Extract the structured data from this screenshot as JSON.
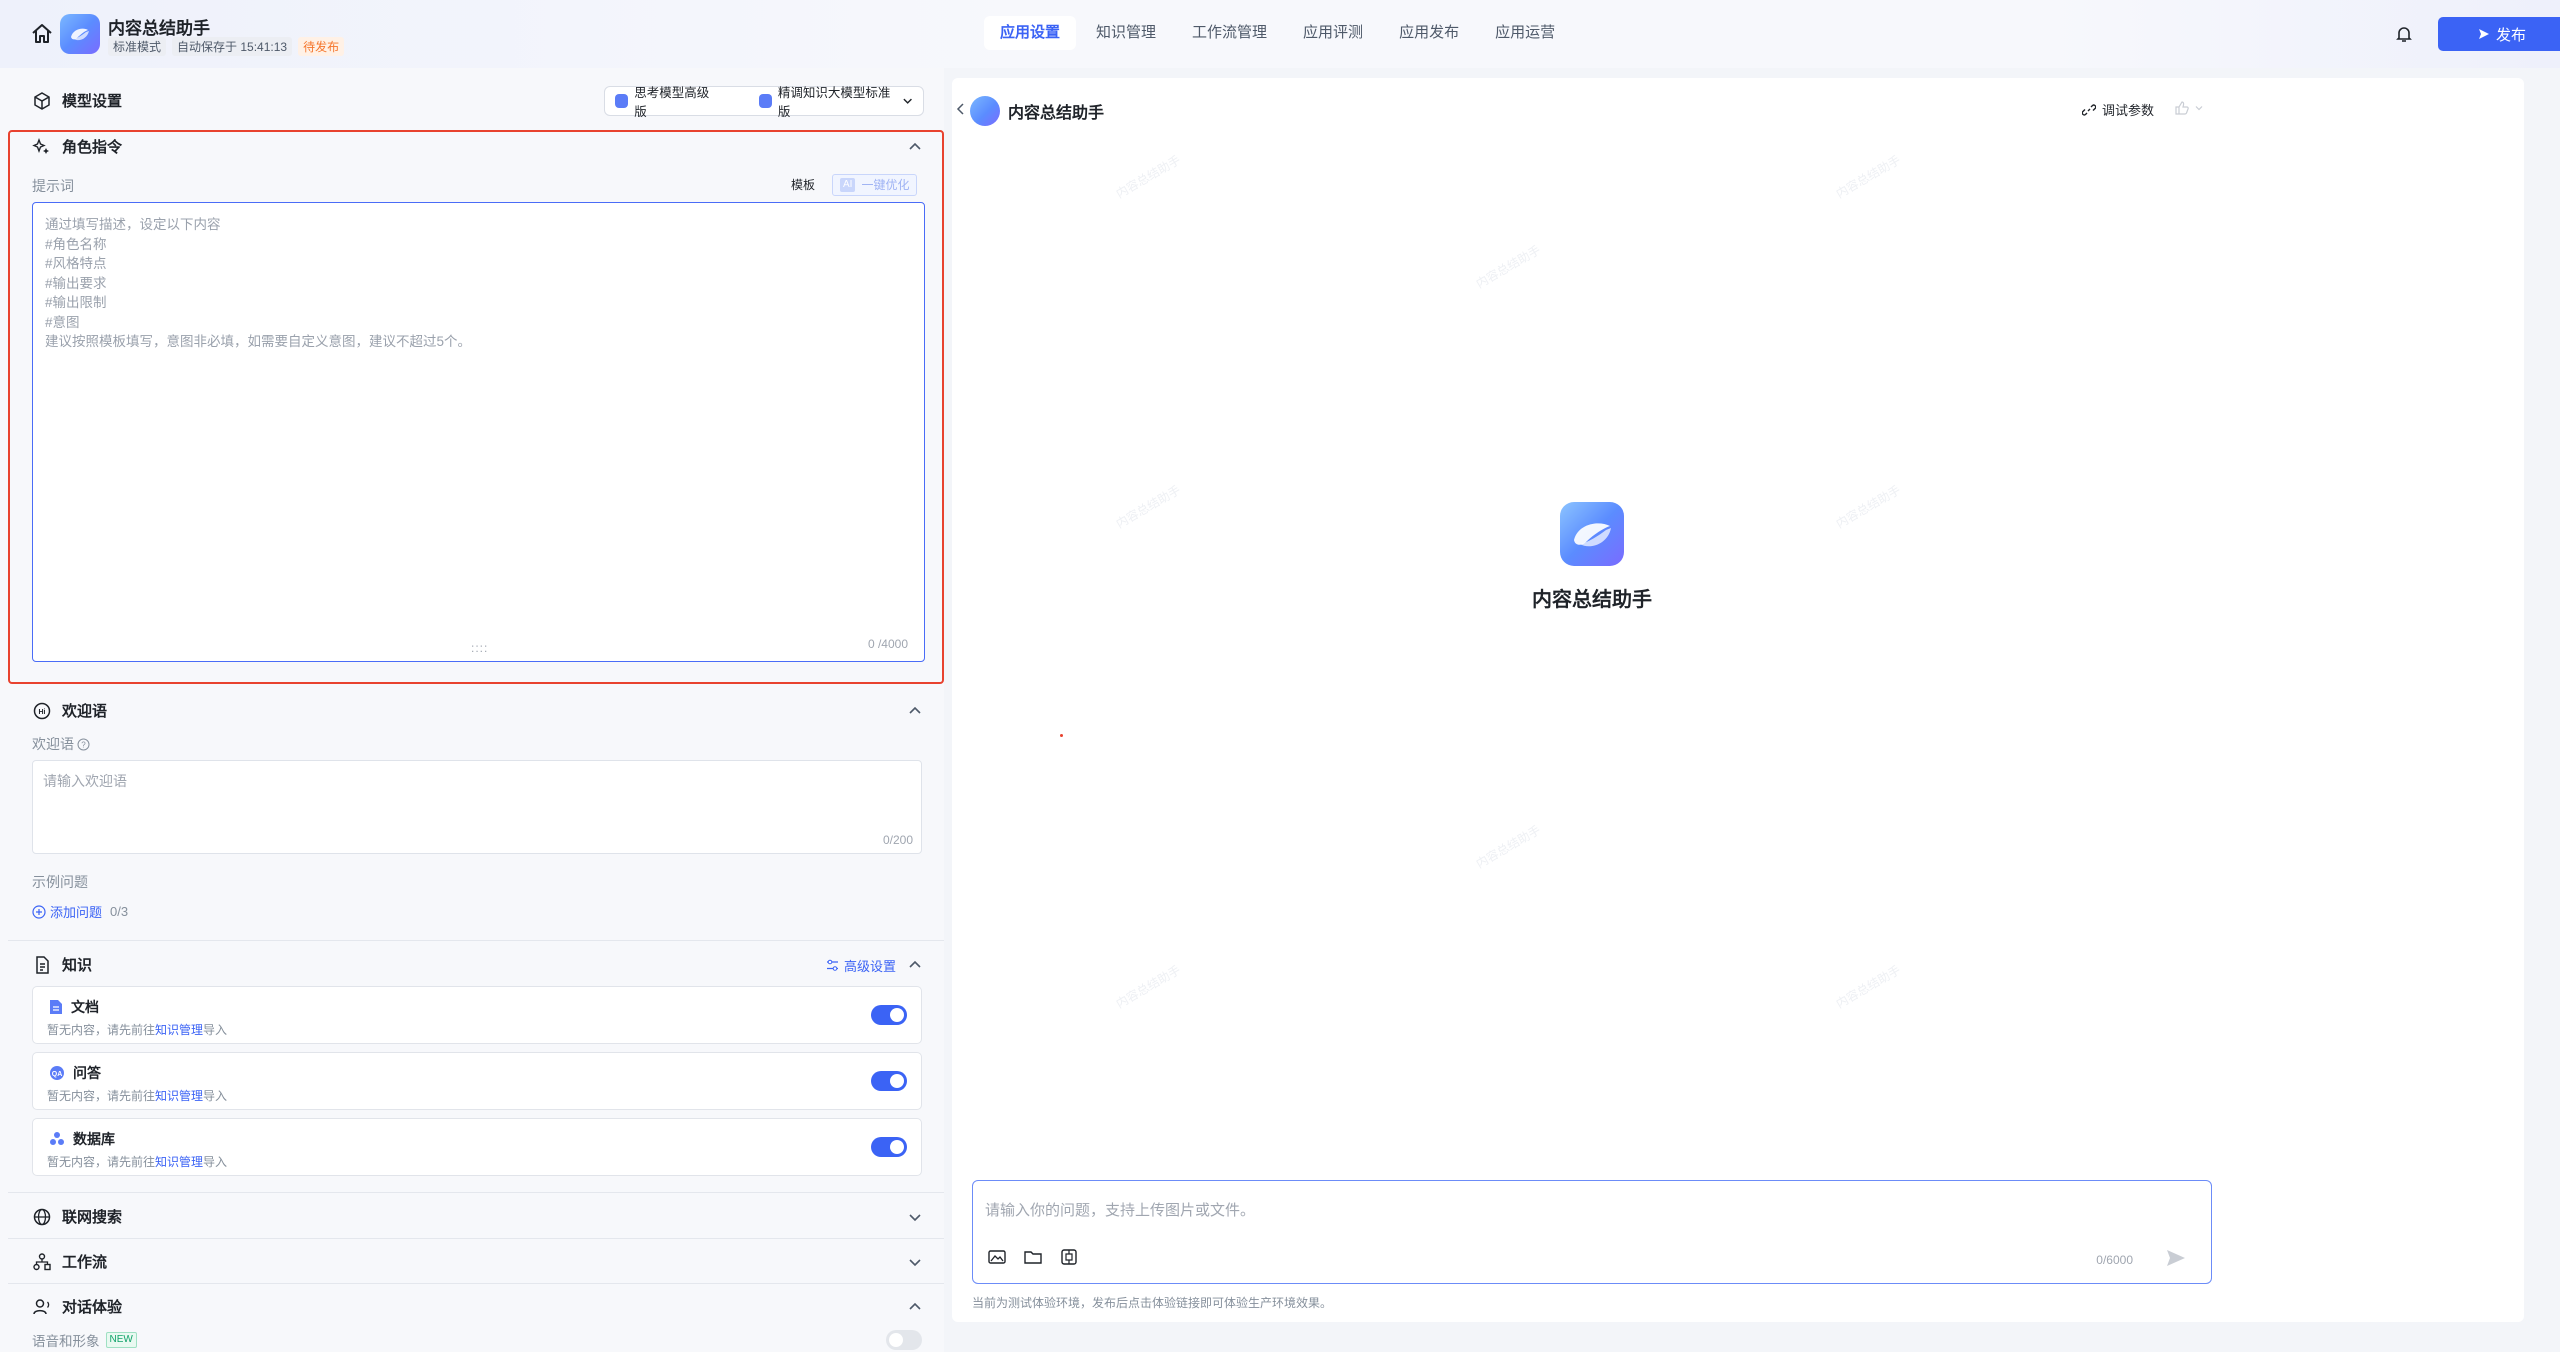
{
  "header": {
    "app_name": "内容总结助手",
    "mode": "标准模式",
    "autosave": "自动保存于 15:41:13",
    "status": "待发布",
    "tabs": [
      "应用设置",
      "知识管理",
      "工作流管理",
      "应用评测",
      "应用发布",
      "应用运营"
    ],
    "active_tab": "应用设置",
    "publish_label": "发布"
  },
  "model": {
    "title": "模型设置",
    "option_a": "思考模型高级版",
    "option_b": "精调知识大模型标准版"
  },
  "role": {
    "title": "角色指令",
    "prompt_label": "提示词",
    "template_btn": "模板",
    "optimize_badge": "AI",
    "optimize_btn": "一键优化",
    "placeholder": "通过填写描述，设定以下内容\n#角色名称\n#风格特点\n#输出要求\n#输出限制\n#意图\n建议按照模板填写，意图非必填，如需要自定义意图，建议不超过5个。",
    "counter": "0 /4000"
  },
  "welcome": {
    "title": "欢迎语",
    "label": "欢迎语",
    "placeholder": "请输入欢迎语",
    "counter": "0/200",
    "examples_label": "示例问题",
    "add_question": "添加问题",
    "add_count": "0/3"
  },
  "knowledge": {
    "title": "知识",
    "advanced": "高级设置",
    "items": [
      {
        "name": "文档",
        "desc": "暂无内容，请先前往",
        "link": "知识管理",
        "suffix": "导入",
        "enabled": true
      },
      {
        "name": "问答",
        "desc": "暂无内容，请先前往",
        "link": "知识管理",
        "suffix": "导入",
        "enabled": true
      },
      {
        "name": "数据库",
        "desc": "暂无内容，请先前往",
        "link": "知识管理",
        "suffix": "导入",
        "enabled": true
      }
    ]
  },
  "web_search": {
    "title": "联网搜索"
  },
  "workflow": {
    "title": "工作流"
  },
  "dialog": {
    "title": "对话体验",
    "voice_label": "语音和形象",
    "new_badge": "NEW",
    "voice_enabled": false
  },
  "chat": {
    "title": "内容总结助手",
    "debug_params": "调试参数",
    "center_name": "内容总结助手",
    "input_placeholder": "请输入你的问题，支持上传图片或文件。",
    "input_counter": "0/6000",
    "footnote": "当前为测试体验环境，发布后点击体验链接即可体验生产环境效果。"
  },
  "colors": {
    "accent": "#3b63f5",
    "highlight_border": "#e8422f",
    "pending": "#f5762d"
  }
}
